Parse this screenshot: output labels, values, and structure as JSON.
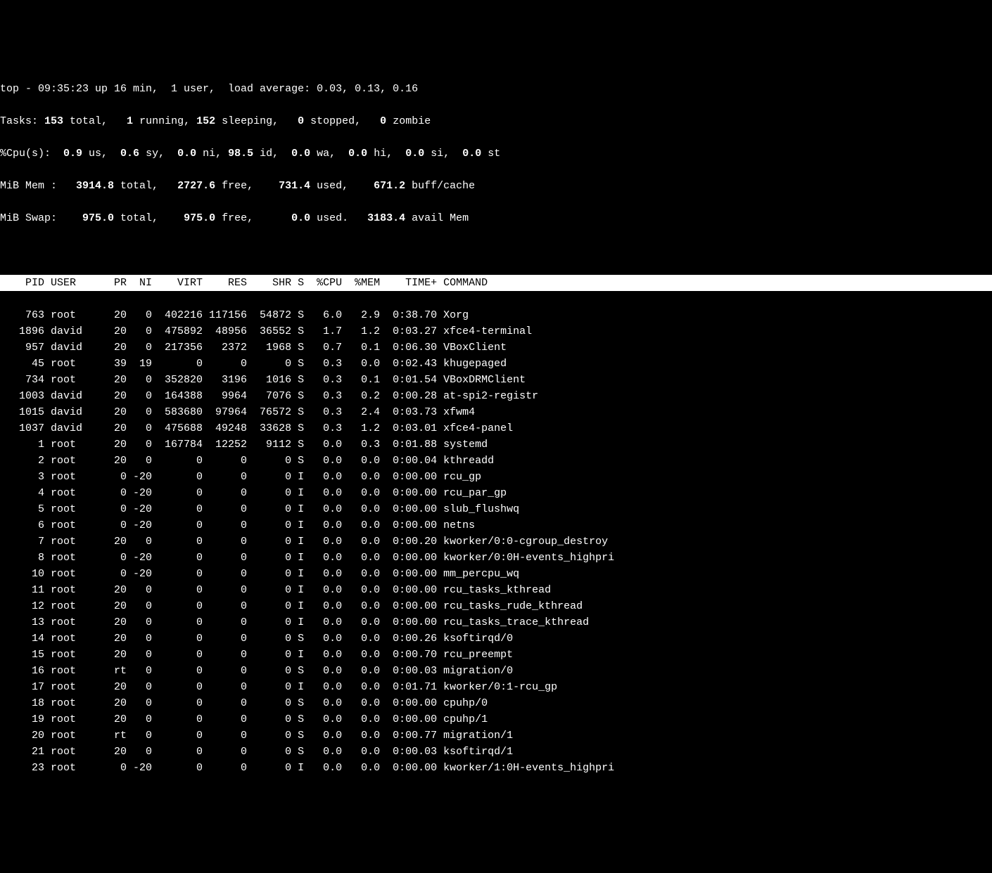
{
  "summary": {
    "line1_pre": "top - 09:35:23 up 16 min,  1 user,  load average: 0.03, 0.13, 0.16",
    "tasks_label": "Tasks: ",
    "tasks_total": "153",
    "tasks_total_suf": " total,   ",
    "tasks_running": "1",
    "tasks_running_suf": " running, ",
    "tasks_sleeping": "152",
    "tasks_sleeping_suf": " sleeping,   ",
    "tasks_stopped": "0",
    "tasks_stopped_suf": " stopped,   ",
    "tasks_zombie": "0",
    "tasks_zombie_suf": " zombie",
    "cpu_label": "%Cpu(s):  ",
    "cpu_us": "0.9",
    "cpu_us_suf": " us,  ",
    "cpu_sy": "0.6",
    "cpu_sy_suf": " sy,  ",
    "cpu_ni": "0.0",
    "cpu_ni_suf": " ni, ",
    "cpu_id": "98.5",
    "cpu_id_suf": " id,  ",
    "cpu_wa": "0.0",
    "cpu_wa_suf": " wa,  ",
    "cpu_hi": "0.0",
    "cpu_hi_suf": " hi,  ",
    "cpu_si": "0.0",
    "cpu_si_suf": " si,  ",
    "cpu_st": "0.0",
    "cpu_st_suf": " st",
    "mem_label": "MiB Mem :   ",
    "mem_total": "3914.8",
    "mem_total_suf": " total,   ",
    "mem_free": "2727.6",
    "mem_free_suf": " free,    ",
    "mem_used": "731.4",
    "mem_used_suf": " used,    ",
    "mem_buff": "671.2",
    "mem_buff_suf": " buff/cache",
    "swap_label": "MiB Swap:    ",
    "swap_total": "975.0",
    "swap_total_suf": " total,    ",
    "swap_free": "975.0",
    "swap_free_suf": " free,      ",
    "swap_used": "0.0",
    "swap_used_suf": " used.   ",
    "swap_avail": "3183.4",
    "swap_avail_suf": " avail Mem"
  },
  "columns": [
    "PID",
    "USER",
    "PR",
    "NI",
    "VIRT",
    "RES",
    "SHR",
    "S",
    "%CPU",
    "%MEM",
    "TIME+",
    "COMMAND"
  ],
  "processes": [
    {
      "pid": "763",
      "user": "root",
      "pr": "20",
      "ni": "0",
      "virt": "402216",
      "res": "117156",
      "shr": "54872",
      "s": "S",
      "cpu": "6.0",
      "mem": "2.9",
      "time": "0:38.70",
      "cmd": "Xorg"
    },
    {
      "pid": "1896",
      "user": "david",
      "pr": "20",
      "ni": "0",
      "virt": "475892",
      "res": "48956",
      "shr": "36552",
      "s": "S",
      "cpu": "1.7",
      "mem": "1.2",
      "time": "0:03.27",
      "cmd": "xfce4-terminal"
    },
    {
      "pid": "957",
      "user": "david",
      "pr": "20",
      "ni": "0",
      "virt": "217356",
      "res": "2372",
      "shr": "1968",
      "s": "S",
      "cpu": "0.7",
      "mem": "0.1",
      "time": "0:06.30",
      "cmd": "VBoxClient"
    },
    {
      "pid": "45",
      "user": "root",
      "pr": "39",
      "ni": "19",
      "virt": "0",
      "res": "0",
      "shr": "0",
      "s": "S",
      "cpu": "0.3",
      "mem": "0.0",
      "time": "0:02.43",
      "cmd": "khugepaged"
    },
    {
      "pid": "734",
      "user": "root",
      "pr": "20",
      "ni": "0",
      "virt": "352820",
      "res": "3196",
      "shr": "1016",
      "s": "S",
      "cpu": "0.3",
      "mem": "0.1",
      "time": "0:01.54",
      "cmd": "VBoxDRMClient"
    },
    {
      "pid": "1003",
      "user": "david",
      "pr": "20",
      "ni": "0",
      "virt": "164388",
      "res": "9964",
      "shr": "7076",
      "s": "S",
      "cpu": "0.3",
      "mem": "0.2",
      "time": "0:00.28",
      "cmd": "at-spi2-registr"
    },
    {
      "pid": "1015",
      "user": "david",
      "pr": "20",
      "ni": "0",
      "virt": "583680",
      "res": "97964",
      "shr": "76572",
      "s": "S",
      "cpu": "0.3",
      "mem": "2.4",
      "time": "0:03.73",
      "cmd": "xfwm4"
    },
    {
      "pid": "1037",
      "user": "david",
      "pr": "20",
      "ni": "0",
      "virt": "475688",
      "res": "49248",
      "shr": "33628",
      "s": "S",
      "cpu": "0.3",
      "mem": "1.2",
      "time": "0:03.01",
      "cmd": "xfce4-panel"
    },
    {
      "pid": "1",
      "user": "root",
      "pr": "20",
      "ni": "0",
      "virt": "167784",
      "res": "12252",
      "shr": "9112",
      "s": "S",
      "cpu": "0.0",
      "mem": "0.3",
      "time": "0:01.88",
      "cmd": "systemd"
    },
    {
      "pid": "2",
      "user": "root",
      "pr": "20",
      "ni": "0",
      "virt": "0",
      "res": "0",
      "shr": "0",
      "s": "S",
      "cpu": "0.0",
      "mem": "0.0",
      "time": "0:00.04",
      "cmd": "kthreadd"
    },
    {
      "pid": "3",
      "user": "root",
      "pr": "0",
      "ni": "-20",
      "virt": "0",
      "res": "0",
      "shr": "0",
      "s": "I",
      "cpu": "0.0",
      "mem": "0.0",
      "time": "0:00.00",
      "cmd": "rcu_gp"
    },
    {
      "pid": "4",
      "user": "root",
      "pr": "0",
      "ni": "-20",
      "virt": "0",
      "res": "0",
      "shr": "0",
      "s": "I",
      "cpu": "0.0",
      "mem": "0.0",
      "time": "0:00.00",
      "cmd": "rcu_par_gp"
    },
    {
      "pid": "5",
      "user": "root",
      "pr": "0",
      "ni": "-20",
      "virt": "0",
      "res": "0",
      "shr": "0",
      "s": "I",
      "cpu": "0.0",
      "mem": "0.0",
      "time": "0:00.00",
      "cmd": "slub_flushwq"
    },
    {
      "pid": "6",
      "user": "root",
      "pr": "0",
      "ni": "-20",
      "virt": "0",
      "res": "0",
      "shr": "0",
      "s": "I",
      "cpu": "0.0",
      "mem": "0.0",
      "time": "0:00.00",
      "cmd": "netns"
    },
    {
      "pid": "7",
      "user": "root",
      "pr": "20",
      "ni": "0",
      "virt": "0",
      "res": "0",
      "shr": "0",
      "s": "I",
      "cpu": "0.0",
      "mem": "0.0",
      "time": "0:00.20",
      "cmd": "kworker/0:0-cgroup_destroy"
    },
    {
      "pid": "8",
      "user": "root",
      "pr": "0",
      "ni": "-20",
      "virt": "0",
      "res": "0",
      "shr": "0",
      "s": "I",
      "cpu": "0.0",
      "mem": "0.0",
      "time": "0:00.00",
      "cmd": "kworker/0:0H-events_highpri"
    },
    {
      "pid": "10",
      "user": "root",
      "pr": "0",
      "ni": "-20",
      "virt": "0",
      "res": "0",
      "shr": "0",
      "s": "I",
      "cpu": "0.0",
      "mem": "0.0",
      "time": "0:00.00",
      "cmd": "mm_percpu_wq"
    },
    {
      "pid": "11",
      "user": "root",
      "pr": "20",
      "ni": "0",
      "virt": "0",
      "res": "0",
      "shr": "0",
      "s": "I",
      "cpu": "0.0",
      "mem": "0.0",
      "time": "0:00.00",
      "cmd": "rcu_tasks_kthread"
    },
    {
      "pid": "12",
      "user": "root",
      "pr": "20",
      "ni": "0",
      "virt": "0",
      "res": "0",
      "shr": "0",
      "s": "I",
      "cpu": "0.0",
      "mem": "0.0",
      "time": "0:00.00",
      "cmd": "rcu_tasks_rude_kthread"
    },
    {
      "pid": "13",
      "user": "root",
      "pr": "20",
      "ni": "0",
      "virt": "0",
      "res": "0",
      "shr": "0",
      "s": "I",
      "cpu": "0.0",
      "mem": "0.0",
      "time": "0:00.00",
      "cmd": "rcu_tasks_trace_kthread"
    },
    {
      "pid": "14",
      "user": "root",
      "pr": "20",
      "ni": "0",
      "virt": "0",
      "res": "0",
      "shr": "0",
      "s": "S",
      "cpu": "0.0",
      "mem": "0.0",
      "time": "0:00.26",
      "cmd": "ksoftirqd/0"
    },
    {
      "pid": "15",
      "user": "root",
      "pr": "20",
      "ni": "0",
      "virt": "0",
      "res": "0",
      "shr": "0",
      "s": "I",
      "cpu": "0.0",
      "mem": "0.0",
      "time": "0:00.70",
      "cmd": "rcu_preempt"
    },
    {
      "pid": "16",
      "user": "root",
      "pr": "rt",
      "ni": "0",
      "virt": "0",
      "res": "0",
      "shr": "0",
      "s": "S",
      "cpu": "0.0",
      "mem": "0.0",
      "time": "0:00.03",
      "cmd": "migration/0"
    },
    {
      "pid": "17",
      "user": "root",
      "pr": "20",
      "ni": "0",
      "virt": "0",
      "res": "0",
      "shr": "0",
      "s": "I",
      "cpu": "0.0",
      "mem": "0.0",
      "time": "0:01.71",
      "cmd": "kworker/0:1-rcu_gp"
    },
    {
      "pid": "18",
      "user": "root",
      "pr": "20",
      "ni": "0",
      "virt": "0",
      "res": "0",
      "shr": "0",
      "s": "S",
      "cpu": "0.0",
      "mem": "0.0",
      "time": "0:00.00",
      "cmd": "cpuhp/0"
    },
    {
      "pid": "19",
      "user": "root",
      "pr": "20",
      "ni": "0",
      "virt": "0",
      "res": "0",
      "shr": "0",
      "s": "S",
      "cpu": "0.0",
      "mem": "0.0",
      "time": "0:00.00",
      "cmd": "cpuhp/1"
    },
    {
      "pid": "20",
      "user": "root",
      "pr": "rt",
      "ni": "0",
      "virt": "0",
      "res": "0",
      "shr": "0",
      "s": "S",
      "cpu": "0.0",
      "mem": "0.0",
      "time": "0:00.77",
      "cmd": "migration/1"
    },
    {
      "pid": "21",
      "user": "root",
      "pr": "20",
      "ni": "0",
      "virt": "0",
      "res": "0",
      "shr": "0",
      "s": "S",
      "cpu": "0.0",
      "mem": "0.0",
      "time": "0:00.03",
      "cmd": "ksoftirqd/1"
    },
    {
      "pid": "23",
      "user": "root",
      "pr": "0",
      "ni": "-20",
      "virt": "0",
      "res": "0",
      "shr": "0",
      "s": "I",
      "cpu": "0.0",
      "mem": "0.0",
      "time": "0:00.00",
      "cmd": "kworker/1:0H-events_highpri"
    }
  ]
}
